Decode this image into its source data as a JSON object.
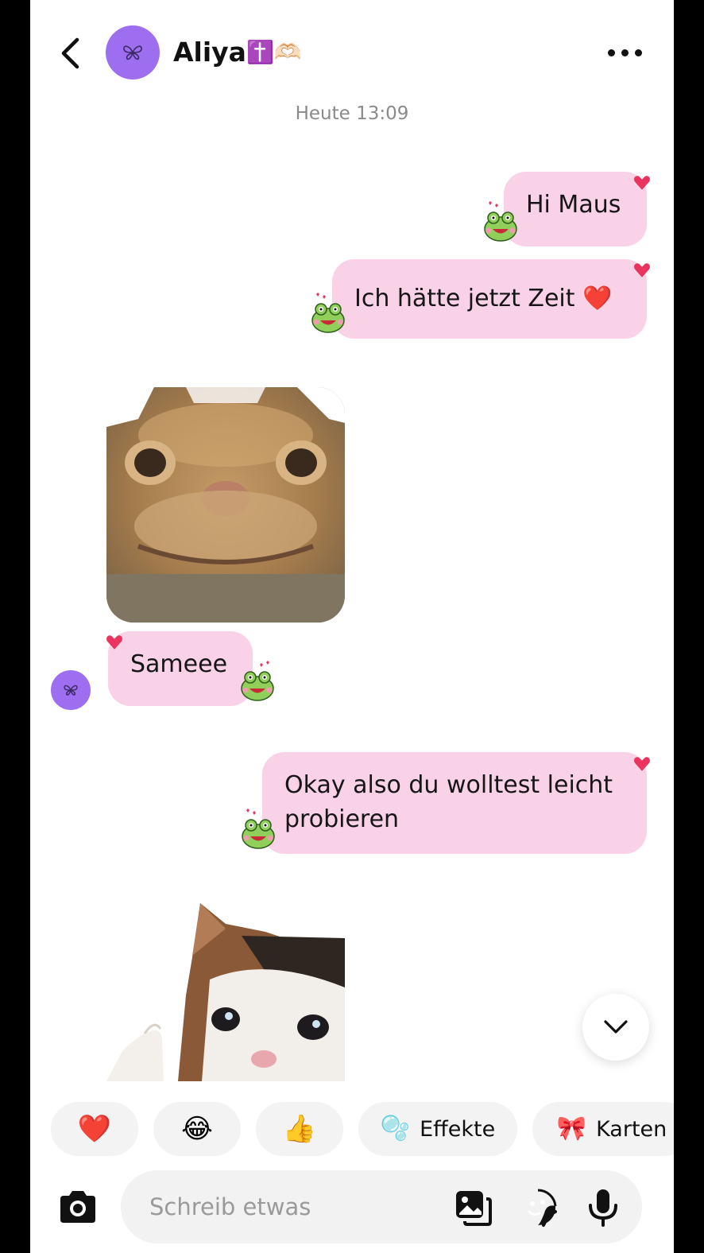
{
  "header": {
    "name": "Aliya",
    "name_emoji": "✝️🫶🏻"
  },
  "timestamp": "Heute 13:09",
  "messages": [
    {
      "text": "Hi Maus"
    },
    {
      "text": "Ich hätte jetzt Zeit",
      "emoji": "❤️"
    },
    {
      "text": "Sameee"
    },
    {
      "line1": "Okay also du wolltest leicht",
      "line2": "probieren"
    }
  ],
  "quick_reactions": [
    {
      "emoji": "❤️"
    },
    {
      "emoji": "😂"
    },
    {
      "emoji": "👍"
    },
    {
      "emoji": "🫧",
      "label": "Effekte"
    },
    {
      "emoji": "🎀",
      "label": "Karten"
    }
  ],
  "composer": {
    "placeholder": "Schreib etwas"
  },
  "colors": {
    "bubble": "#f9d2e8",
    "avatar": "#9d6ef0",
    "heart": "#e8345f"
  }
}
